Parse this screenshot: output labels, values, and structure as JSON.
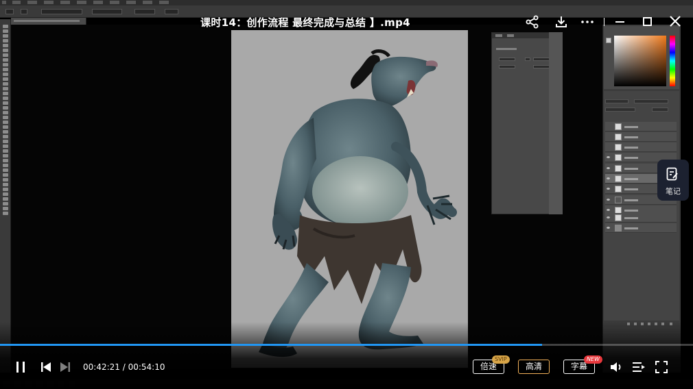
{
  "video": {
    "title": "课时14：创作流程 最终完成与总结 】.mp4",
    "current_time": "00:42:21",
    "total_time": "00:54:10",
    "time_display": "00:42:21 / 00:54:10",
    "progress": 0.782
  },
  "controls": {
    "speed_label": "倍速",
    "speed_badge": "SVIP",
    "quality_label": "高清",
    "subtitle_label": "字幕",
    "subtitle_badge": "NEW"
  },
  "notes": {
    "label": "笔记"
  },
  "icons": {
    "share": "share-icon",
    "download": "download-icon",
    "more": "more-icon",
    "minimize": "minimize-icon",
    "maximize": "maximize-icon",
    "close": "close-icon",
    "pause": "pause-icon",
    "previous": "skip-previous-icon",
    "next": "skip-next-icon",
    "volume": "volume-icon",
    "playlist": "playlist-icon",
    "fullscreen": "fullscreen-icon",
    "notes": "notes-icon"
  },
  "colors": {
    "progress": "#2196f3",
    "quality_border": "#f3b25a",
    "svip_badge": "#d8a548",
    "new_badge": "#e8383d",
    "notes_bg": "#1c2130",
    "artboard_bg": "#a9a9a9",
    "creature_skin": "#4a6068"
  }
}
